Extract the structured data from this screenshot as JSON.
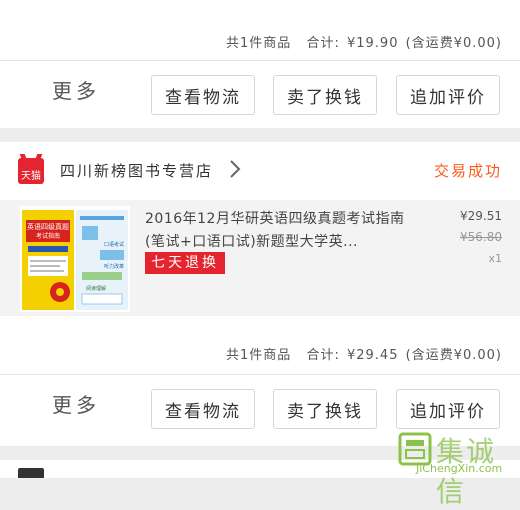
{
  "order1": {
    "summary": {
      "count": "共1件商品",
      "total_label": "合计:",
      "total": "¥19.90",
      "shipping": "(含运费¥0.00)"
    }
  },
  "actions": {
    "more": "更多",
    "logistics": "查看物流",
    "resell": "卖了换钱",
    "review": "追加评价"
  },
  "order2": {
    "shop": {
      "logo_text": "天猫",
      "name": "四川新榜图书专营店"
    },
    "status": "交易成功",
    "item": {
      "title": "2016年12月华研英语四级真题考试指南(笔试+口语口试)新题型大学英...",
      "tag": "七天退换",
      "price": "¥29.51",
      "original_price": "¥56.80",
      "quantity": "x1",
      "cover": {
        "line1": "英语四级真题",
        "line2": "考试指南",
        "line3": "口语考试",
        "line4": "听力改革",
        "line5": "阅读理解"
      }
    },
    "summary": {
      "count": "共1件商品",
      "total_label": "合计:",
      "total": "¥29.45",
      "shipping": "(含运费¥0.00)"
    }
  },
  "watermark": {
    "cn": "集诚信",
    "en": "JiChengXin.com"
  },
  "colors": {
    "accent_red": "#e4242f",
    "status_orange": "#ff5a1a",
    "watermark_green": "#8bc34a"
  }
}
